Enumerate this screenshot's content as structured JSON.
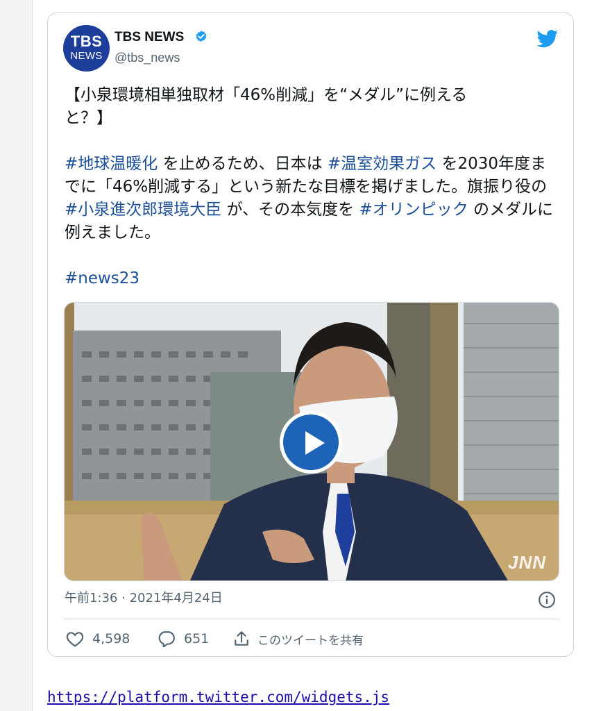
{
  "tweet": {
    "avatar_line1": "TBS",
    "avatar_line2": "NEWS",
    "display_name": "TBS NEWS",
    "handle": "@tbs_news",
    "text_line1": "【小泉環境相単独取材「46%削減」を“メダル”に例える",
    "text_line2": "と？】",
    "p2_hashtag1": "#地球温暖化",
    "p2_text1": " を止めるため、日本は ",
    "p2_hashtag2": "#温室効果ガス",
    "p2_text2": " を2030年度までに「46%削減する」という新たな目標を掲げました。旗振り役の ",
    "p2_hashtag3": "#小泉進次郎環境大臣",
    "p2_text3": " が、その本気度を ",
    "p2_hashtag4": "#オリンピック",
    "p2_text4": " のメダルに例えました。",
    "hashtag_news": "#news23",
    "video_watermark": "JNN",
    "timestamp": "午前1:36 · 2021年4月24日",
    "like_count": "4,598",
    "reply_count": "651",
    "share_label": "このツイートを共有"
  },
  "footer": {
    "link": "https://platform.twitter.com/widgets.js"
  },
  "colors": {
    "accent": "#1d9bf0",
    "hashtag": "#1b4f9a",
    "play_button": "#1d63b8",
    "avatar_bg": "#1d3e9b",
    "muted_text": "#536471"
  },
  "icons": [
    "verified-badge-icon",
    "twitter-bird-icon",
    "play-icon",
    "info-icon",
    "heart-icon",
    "reply-icon",
    "share-icon"
  ]
}
